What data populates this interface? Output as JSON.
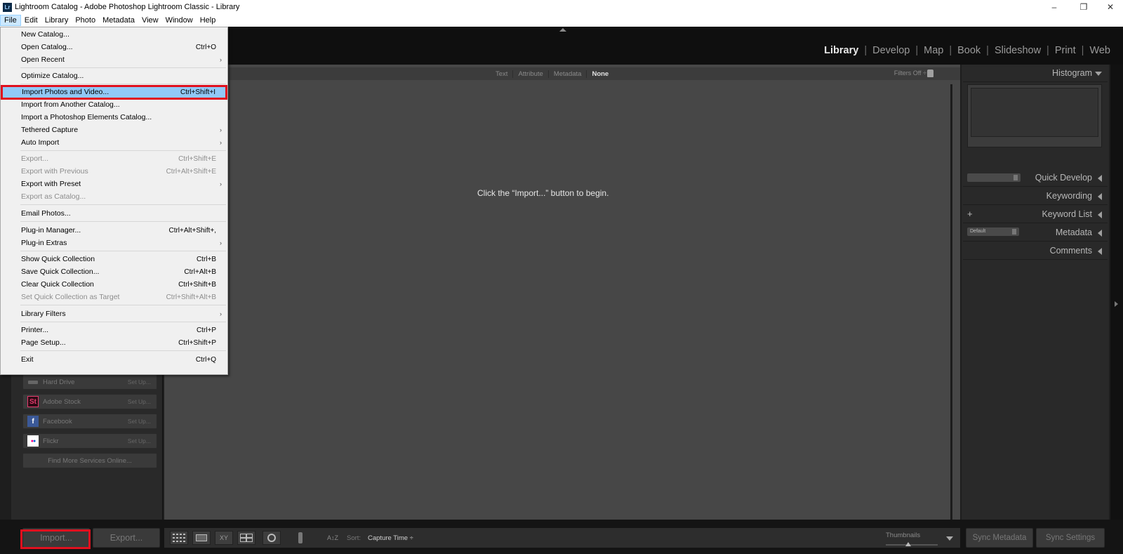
{
  "window": {
    "title": "Lightroom Catalog - Adobe Photoshop Lightroom Classic - Library",
    "app_icon": "Lr",
    "controls": {
      "minimize": "–",
      "restore": "❐",
      "close": "✕"
    }
  },
  "menubar": {
    "items": [
      "File",
      "Edit",
      "Library",
      "Photo",
      "Metadata",
      "View",
      "Window",
      "Help"
    ],
    "active": "File"
  },
  "modules": [
    "Library",
    "Develop",
    "Map",
    "Book",
    "Slideshow",
    "Print",
    "Web"
  ],
  "active_module": "Library",
  "module_separator": "|",
  "file_menu": {
    "items": [
      {
        "label": "New Catalog...",
        "shortcut": "",
        "submenu": false,
        "disabled": false
      },
      {
        "label": "Open Catalog...",
        "shortcut": "Ctrl+O",
        "submenu": false,
        "disabled": false
      },
      {
        "label": "Open Recent",
        "shortcut": "",
        "submenu": true,
        "disabled": false
      },
      {
        "label": "Optimize Catalog...",
        "shortcut": "",
        "submenu": false,
        "disabled": false
      },
      {
        "label": "Import Photos and Video...",
        "shortcut": "Ctrl+Shift+I",
        "submenu": false,
        "disabled": false,
        "highlighted": true
      },
      {
        "label": "Import from Another Catalog...",
        "shortcut": "",
        "submenu": false,
        "disabled": false
      },
      {
        "label": "Import a Photoshop Elements Catalog...",
        "shortcut": "",
        "submenu": false,
        "disabled": false
      },
      {
        "label": "Tethered Capture",
        "shortcut": "",
        "submenu": true,
        "disabled": false
      },
      {
        "label": "Auto Import",
        "shortcut": "",
        "submenu": true,
        "disabled": false
      },
      {
        "label": "Export...",
        "shortcut": "Ctrl+Shift+E",
        "submenu": false,
        "disabled": true
      },
      {
        "label": "Export with Previous",
        "shortcut": "Ctrl+Alt+Shift+E",
        "submenu": false,
        "disabled": true
      },
      {
        "label": "Export with Preset",
        "shortcut": "",
        "submenu": true,
        "disabled": false
      },
      {
        "label": "Export as Catalog...",
        "shortcut": "",
        "submenu": false,
        "disabled": true
      },
      {
        "label": "Email Photos...",
        "shortcut": "",
        "submenu": false,
        "disabled": false
      },
      {
        "label": "Plug-in Manager...",
        "shortcut": "Ctrl+Alt+Shift+,",
        "submenu": false,
        "disabled": false
      },
      {
        "label": "Plug-in Extras",
        "shortcut": "",
        "submenu": true,
        "disabled": false
      },
      {
        "label": "Show Quick Collection",
        "shortcut": "Ctrl+B",
        "submenu": false,
        "disabled": false
      },
      {
        "label": "Save Quick Collection...",
        "shortcut": "Ctrl+Alt+B",
        "submenu": false,
        "disabled": false
      },
      {
        "label": "Clear Quick Collection",
        "shortcut": "Ctrl+Shift+B",
        "submenu": false,
        "disabled": false
      },
      {
        "label": "Set Quick Collection as Target",
        "shortcut": "Ctrl+Shift+Alt+B",
        "submenu": false,
        "disabled": true
      },
      {
        "label": "Library Filters",
        "shortcut": "",
        "submenu": true,
        "disabled": false
      },
      {
        "label": "Printer...",
        "shortcut": "Ctrl+P",
        "submenu": false,
        "disabled": false
      },
      {
        "label": "Page Setup...",
        "shortcut": "Ctrl+Shift+P",
        "submenu": false,
        "disabled": false
      },
      {
        "label": "Exit",
        "shortcut": "Ctrl+Q",
        "submenu": false,
        "disabled": false
      }
    ],
    "submenu_glyph": "›"
  },
  "publish_services": [
    {
      "name": "Hard Drive",
      "action": "Set Up...",
      "icon": "hard-drive-icon",
      "glyph": ""
    },
    {
      "name": "Adobe Stock",
      "action": "Set Up...",
      "icon": "adobe-stock-icon",
      "glyph": "St"
    },
    {
      "name": "Facebook",
      "action": "Set Up...",
      "icon": "facebook-icon",
      "glyph": "f"
    },
    {
      "name": "Flickr",
      "action": "Set Up...",
      "icon": "flickr-icon",
      "glyph": "●●"
    }
  ],
  "find_more_services": "Find More Services Online...",
  "filter_bar": {
    "tabs": [
      "Text",
      "Attribute",
      "Metadata",
      "None"
    ],
    "active": "None",
    "filters_off": "Filters Off ÷"
  },
  "center_hint": "Click the “Import...” button to begin.",
  "right_panel": {
    "histogram": "Histogram",
    "quick_develop": "Quick Develop",
    "keywording": "Keywording",
    "keyword_list": "Keyword List",
    "keyword_add": "+",
    "metadata": "Metadata",
    "metadata_preset": "Default",
    "comments": "Comments"
  },
  "bottom": {
    "import_button": "Import...",
    "export_button": "Export...",
    "sort_label": "Sort:",
    "sort_value": "Capture Time ÷",
    "thumbnails_label": "Thumbnails",
    "sync_metadata": "Sync Metadata",
    "sync_settings": "Sync Settings",
    "view_icons": [
      "grid-view-icon",
      "loupe-view-icon",
      "compare-view-icon",
      "survey-view-icon",
      "people-view-icon"
    ],
    "compare_glyph": "XY",
    "sort_direction_glyph": "A↕Z"
  },
  "colors": {
    "highlight_box": "#e0101e",
    "menu_highlight": "#91c9f7",
    "panel_bg": "#292929",
    "center_bg": "#474747"
  }
}
